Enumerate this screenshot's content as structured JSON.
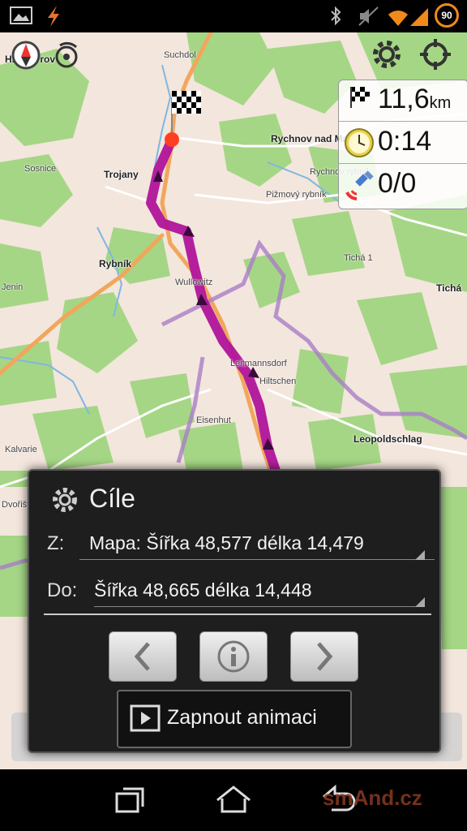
{
  "status_bar": {
    "battery_level": "90",
    "icons": [
      "image-icon",
      "flash-icon",
      "bluetooth-icon",
      "mute-icon",
      "wifi-icon",
      "signal-icon",
      "battery-icon"
    ]
  },
  "map": {
    "towns": [
      {
        "name": "Hladný rov"
      },
      {
        "name": "Suchdol"
      },
      {
        "name": "Rychnov nad Mal."
      },
      {
        "name": "Sosnice"
      },
      {
        "name": "Trojany"
      },
      {
        "name": "Rychnov rybník"
      },
      {
        "name": "Pižmový rybník"
      },
      {
        "name": "Rybník"
      },
      {
        "name": "Tichá 1"
      },
      {
        "name": "Tichá"
      },
      {
        "name": "Jenin"
      },
      {
        "name": "Wullowitz"
      },
      {
        "name": "Leopoldschlag"
      },
      {
        "name": "Eisenhut"
      },
      {
        "name": "Kalvarie"
      },
      {
        "name": "Dvořiště"
      },
      {
        "name": "Leitmannsdorf"
      },
      {
        "name": "Hiltschen"
      }
    ],
    "toolbar_icons": [
      "compass-icon",
      "gps-icon",
      "gear-icon",
      "crosshair-icon"
    ]
  },
  "info_panel": {
    "distance_value": "11,6",
    "distance_unit": "km",
    "time_value": "0:14",
    "satellites_value": "0/0"
  },
  "dialog": {
    "title": "Cíle",
    "from_label": "Z:",
    "from_value": "Mapa: Šířka 48,577 délka 14,479",
    "to_label": "Do:",
    "to_value": "Šířka 48,665 délka 14,448",
    "animation_button": "Zapnout animaci"
  },
  "nav_bar": {
    "keys": [
      "recent-apps-icon",
      "home-icon",
      "back-icon"
    ]
  },
  "watermark": "smAnd.cz",
  "colors": {
    "route": "#b0149a",
    "forest": "#9fd07e",
    "road": "#f2a65c",
    "border": "#a97ec7"
  }
}
